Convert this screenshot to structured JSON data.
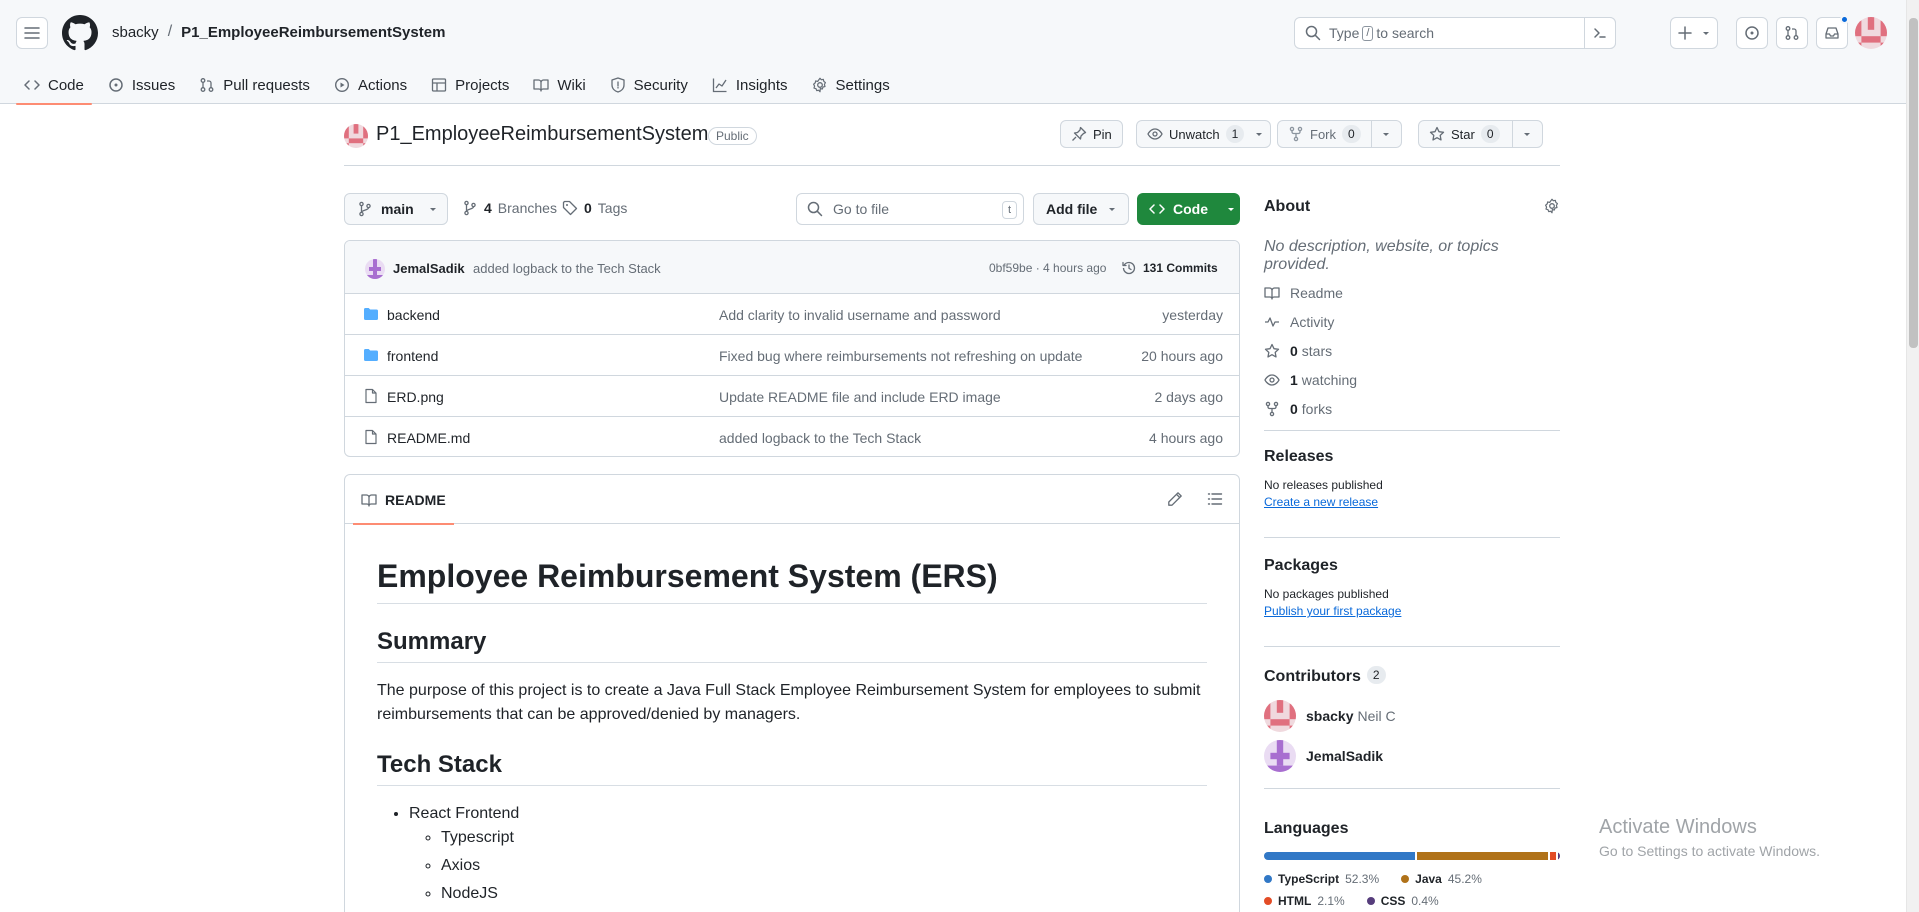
{
  "header": {
    "owner": "sbacky",
    "repo": "P1_EmployeeReimbursementSystem",
    "search_prefix": "Type",
    "search_key": "/",
    "search_suffix": "to search"
  },
  "repo_nav": {
    "tabs": [
      {
        "label": "Code",
        "icon": "code-icon",
        "active": true
      },
      {
        "label": "Issues",
        "icon": "issue-icon"
      },
      {
        "label": "Pull requests",
        "icon": "pull-request-icon"
      },
      {
        "label": "Actions",
        "icon": "play-icon"
      },
      {
        "label": "Projects",
        "icon": "table-icon"
      },
      {
        "label": "Wiki",
        "icon": "book-icon"
      },
      {
        "label": "Security",
        "icon": "shield-icon"
      },
      {
        "label": "Insights",
        "icon": "graph-icon"
      },
      {
        "label": "Settings",
        "icon": "gear-icon"
      }
    ]
  },
  "repo_head": {
    "name": "P1_EmployeeReimbursementSystem",
    "visibility": "Public",
    "pin_label": "Pin",
    "watch_label": "Unwatch",
    "watch_count": "1",
    "fork_label": "Fork",
    "fork_count": "0",
    "star_label": "Star",
    "star_count": "0"
  },
  "toolbar": {
    "branch": "main",
    "branches_count": "4",
    "branches_label": "Branches",
    "tags_count": "0",
    "tags_label": "Tags",
    "goto_placeholder": "Go to file",
    "goto_key": "t",
    "add_file_label": "Add file",
    "code_label": "Code"
  },
  "latest_commit": {
    "author": "JemalSadik",
    "message": "added logback to the Tech Stack",
    "hash_time": "0bf59be · 4 hours ago",
    "commits": "131 Commits"
  },
  "files": [
    {
      "name": "backend",
      "type": "dir",
      "message": "Add clarity to invalid username and password",
      "time": "yesterday"
    },
    {
      "name": "frontend",
      "type": "dir",
      "message": "Fixed bug where reimbursements not refreshing on update",
      "time": "20 hours ago"
    },
    {
      "name": "ERD.png",
      "type": "file",
      "message": "Update README file and include ERD image",
      "time": "2 days ago"
    },
    {
      "name": "README.md",
      "type": "file",
      "message": "added logback to the Tech Stack",
      "time": "4 hours ago"
    }
  ],
  "readme": {
    "tab_label": "README",
    "title": "Employee Reimbursement System (ERS)",
    "summary_heading": "Summary",
    "summary_text": "The purpose of this project is to create a Java Full Stack Employee Reimbursement System for employees to submit reimbursements that can be approved/denied by managers.",
    "tech_heading": "Tech Stack",
    "tech_item": "React Frontend",
    "tech_sub": [
      "Typescript",
      "Axios",
      "NodeJS"
    ]
  },
  "about": {
    "title": "About",
    "description": "No description, website, or topics provided.",
    "items": [
      {
        "icon": "book-icon",
        "bold": "",
        "text": "Readme"
      },
      {
        "icon": "pulse-icon",
        "bold": "",
        "text": "Activity"
      },
      {
        "icon": "star-icon",
        "bold": "0",
        "text": "stars"
      },
      {
        "icon": "eye-icon",
        "bold": "1",
        "text": "watching"
      },
      {
        "icon": "fork-icon",
        "bold": "0",
        "text": "forks"
      }
    ]
  },
  "releases": {
    "title": "Releases",
    "empty": "No releases published",
    "link": "Create a new release"
  },
  "packages": {
    "title": "Packages",
    "empty": "No packages published",
    "link": "Publish your first package"
  },
  "contributors": {
    "title": "Contributors",
    "count": "2",
    "people": [
      {
        "login": "sbacky",
        "name": "Neil C"
      },
      {
        "login": "JemalSadik",
        "name": ""
      }
    ]
  },
  "languages": {
    "title": "Languages",
    "items": [
      {
        "name": "TypeScript",
        "percent": "52.3%",
        "value": 52.3,
        "color": "#3178c6"
      },
      {
        "name": "Java",
        "percent": "45.2%",
        "value": 45.2,
        "color": "#b07219"
      },
      {
        "name": "HTML",
        "percent": "2.1%",
        "value": 2.1,
        "color": "#e34c26"
      },
      {
        "name": "CSS",
        "percent": "0.4%",
        "value": 0.4,
        "color": "#563d7c"
      }
    ]
  },
  "watermark": {
    "line1": "Activate Windows",
    "line2": "Go to Settings to activate Windows."
  }
}
